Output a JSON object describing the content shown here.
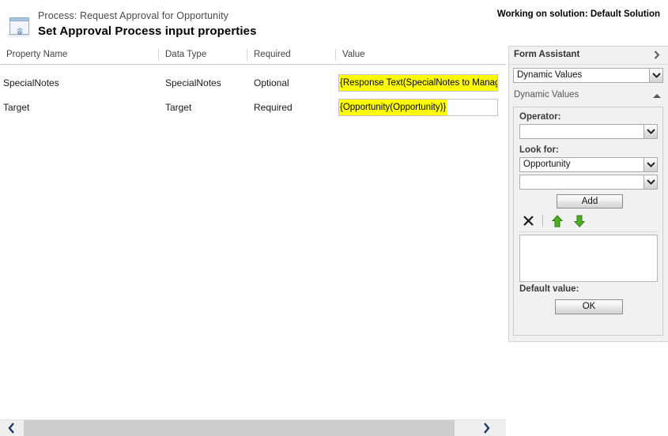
{
  "header": {
    "icon": "process-dialog-gear-icon",
    "subtitle": "Process: Request Approval for Opportunity",
    "title": "Set Approval Process input properties",
    "solution_status": "Working on solution: Default Solution"
  },
  "grid": {
    "columns": [
      "Property Name",
      "Data Type",
      "Required",
      "Value"
    ],
    "rows": [
      {
        "property_name": "SpecialNotes",
        "data_type": "SpecialNotes",
        "required": "Optional",
        "value": "{Response Text(SpecialNotes to Manager)}"
      },
      {
        "property_name": "Target",
        "data_type": "Target",
        "required": "Required",
        "value": "{Opportunity(Opportunity)}"
      }
    ]
  },
  "form_assistant": {
    "title": "Form Assistant",
    "expand_icon": "chevron-right-icon",
    "type_select": {
      "value": "Dynamic Values",
      "arrow_icon": "chevron-down-icon"
    },
    "section": {
      "label": "Dynamic Values",
      "collapse_icon": "triangle-up-icon"
    },
    "operator": {
      "label": "Operator:",
      "value": "",
      "arrow_icon": "chevron-down-icon"
    },
    "look_for": {
      "label": "Look for:",
      "value": "Opportunity",
      "arrow_icon": "chevron-down-icon"
    },
    "look_for_field": {
      "value": "",
      "arrow_icon": "chevron-down-icon"
    },
    "add_button": "Add",
    "toolbar": {
      "delete_icon": "delete-x-icon",
      "move_up_icon": "arrow-up-green-icon",
      "move_down_icon": "arrow-down-green-icon"
    },
    "values_list": [],
    "default_value_label": "Default value:",
    "ok_button": "OK"
  },
  "scrollbar": {
    "left_icon": "chevron-left-icon",
    "right_icon": "chevron-right-icon"
  },
  "colors": {
    "highlight": "#ffff00",
    "panel_bg": "#f1f1f1",
    "scroll_thumb": "#cdcdcd",
    "arrow_green": "#4caf20",
    "chevron_navy": "#1f3864"
  }
}
